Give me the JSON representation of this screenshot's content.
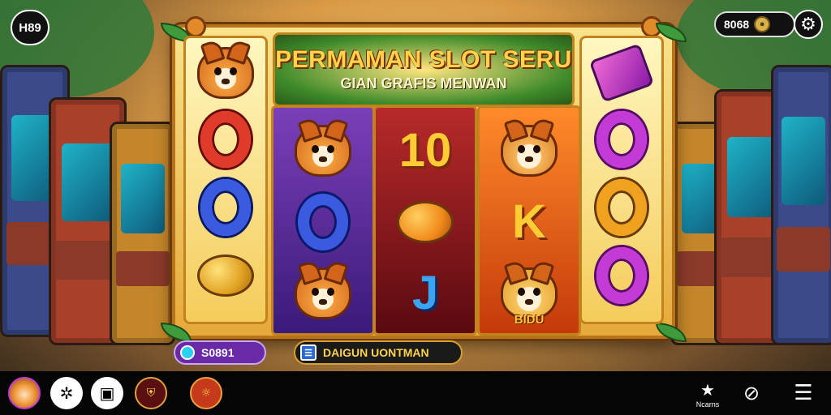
{
  "header": {
    "logo_text": "H89",
    "balance": "8068",
    "coin_glyph": "●",
    "settings_icon": "gear-icon",
    "settings_glyph": "⚙"
  },
  "machine": {
    "title": "PERMAMAN SLOT SERU",
    "subtitle": "GIAN GRAFIS MENWAN",
    "reels": [
      [
        "cat-face",
        "blue-ring",
        "cat-face"
      ],
      [
        "10",
        "orange-fruit",
        "J"
      ],
      [
        "cat-face",
        "K",
        "cat-face BIDU"
      ]
    ],
    "left_column": [
      "cat-face",
      "red-ring",
      "blue-ring",
      "yellow-fruit"
    ],
    "right_column": [
      "pink-gem",
      "pink-ring",
      "orange-ring",
      "pink-ring"
    ],
    "symbol_labels": {
      "ten": "10",
      "k": "K",
      "j": "J",
      "bidu": "BIDU"
    }
  },
  "footer_pills": {
    "win_amount": "S0891",
    "action_label": "DAIGUN UONTMAN",
    "action_icon_glyph": "☰"
  },
  "bottom_bar": {
    "fish_glyph": "✲",
    "chat_glyph": "▣",
    "shield_glyph": "⛨",
    "emblem_glyph": "☼",
    "star_glyph": "★",
    "star_label": "Ncarns",
    "search_glyph": "⊘",
    "menu_glyph": "☰"
  },
  "colors": {
    "accent_gold": "#ffcc33",
    "reel_purple": "#7b3fb8",
    "reel_red": "#b82a2a",
    "reel_orange": "#ff8a2a"
  }
}
